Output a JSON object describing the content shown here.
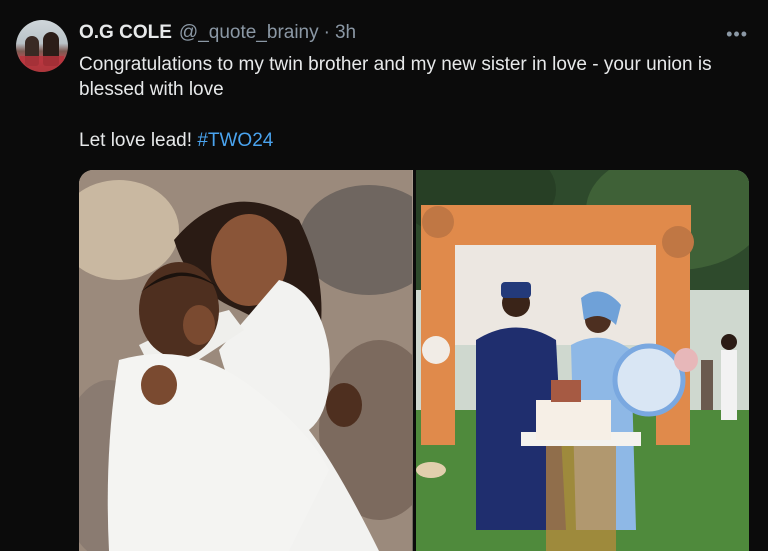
{
  "tweet": {
    "display_name": "O.G COLE",
    "handle": "@_quote_brainy",
    "separator": "·",
    "time": "3h",
    "more_icon": "more-horizontal-icon",
    "text_line1": "Congratulations to my twin brother and my new sister in love - your union is blessed with love",
    "text_line2_prefix": "Let love lead! ",
    "hashtag": "#TWO24"
  },
  "media": {
    "count": 2
  },
  "colors": {
    "background": "#0b0b0b",
    "text": "#e7e9ea",
    "secondary": "#8b98a5",
    "link": "#4aa3ee"
  }
}
